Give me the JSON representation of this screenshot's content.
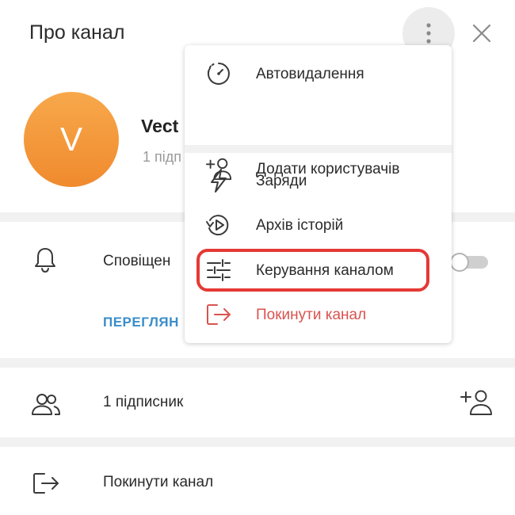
{
  "header": {
    "title": "Про канал"
  },
  "channel": {
    "avatar_letter": "V",
    "name": "Vect",
    "subscribers_partial": "1 підп"
  },
  "notifications": {
    "label": "Сповіщен",
    "view_link": "ПЕРЕГЛЯН",
    "toggle_on": false
  },
  "subscribers": {
    "label": "1 підписник"
  },
  "leave": {
    "label": "Покинути канал"
  },
  "menu": {
    "auto_delete": "Автовидалення",
    "add_users": "Додати користувачів",
    "boosts": "Заряди",
    "stories_archive": "Архів історій",
    "manage_channel": "Керування каналом",
    "leave_channel": "Покинути канал"
  },
  "colors": {
    "accent_link": "#3a8dc9",
    "danger": "#d9534f",
    "highlight": "#e53935",
    "avatar": "#f29436"
  }
}
